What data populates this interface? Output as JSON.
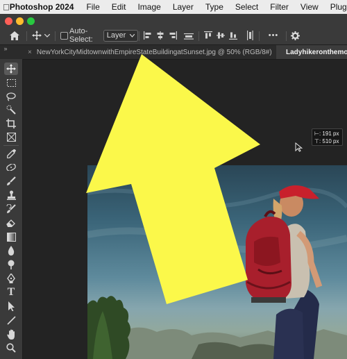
{
  "menubar": {
    "apple_icon": "apple-logo-icon",
    "app_name": "Photoshop 2024",
    "items": [
      "File",
      "Edit",
      "Image",
      "Layer",
      "Type",
      "Select",
      "Filter",
      "View",
      "Plugins"
    ]
  },
  "options": {
    "auto_select_label": "Auto-Select:",
    "auto_select_checked": false,
    "target_value": "Layer",
    "more_label": "•••"
  },
  "tabs": [
    {
      "label": "NewYorkCityMidtownwithEmpireStateBuildingatSunset.jpg @ 50% (RGB/8#)",
      "active": false,
      "close": "×"
    },
    {
      "label": "Ladyhikeronthemou",
      "active": true
    }
  ],
  "toolbar": {
    "collapse_label": "»",
    "tools": [
      "move-tool",
      "marquee-tool",
      "lasso-tool",
      "quick-selection-tool",
      "crop-tool",
      "frame-tool",
      "eyedropper-tool",
      "spot-healing-tool",
      "brush-tool",
      "clone-stamp-tool",
      "history-brush-tool",
      "eraser-tool",
      "gradient-tool",
      "blur-tool",
      "dodge-tool",
      "pen-tool",
      "type-tool",
      "path-selection-tool",
      "line-tool",
      "hand-tool",
      "zoom-tool"
    ]
  },
  "readout": {
    "width_label": "191 px",
    "height_label": "510 px"
  },
  "annotation": {
    "arrow_color": "#fbf84a",
    "direction": "up-left"
  },
  "colors": {
    "menubar_bg": "#ececec",
    "options_bg": "#3a3a3a",
    "canvas_bg": "#232323",
    "backpack": "#a81f2c",
    "cap": "#c8202c"
  }
}
